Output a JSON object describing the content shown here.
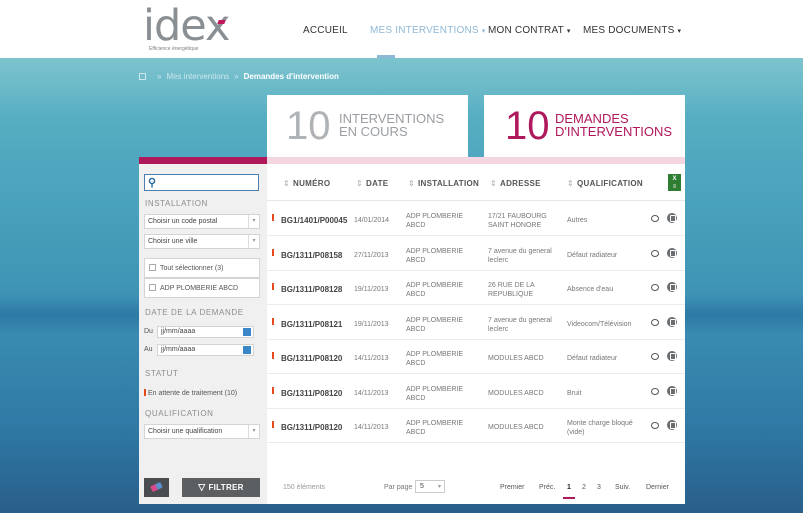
{
  "brand": {
    "logo": "idex",
    "tagline": "Efficience énergétique"
  },
  "nav": [
    {
      "label": "ACCUEIL",
      "caret": ""
    },
    {
      "label": "MES INTERVENTIONS",
      "caret": "▾"
    },
    {
      "label": "MON CONTRAT",
      "caret": "▾"
    },
    {
      "label": "MES DOCUMENTS",
      "caret": "▾"
    }
  ],
  "breadcrumb": {
    "sep": "»",
    "level1": "Mes interventions",
    "current": "Demandes d'intervention"
  },
  "counters": {
    "en_cours": {
      "value": "10",
      "line1": "INTERVENTIONS",
      "line2": "EN COURS"
    },
    "demandes": {
      "value": "10",
      "line1": "DEMANDES",
      "line2": "D'INTERVENTIONS"
    }
  },
  "sidebar": {
    "installation_title": "INSTALLATION",
    "code_postal": "Choisir un code postal",
    "ville": "Choisir une ville",
    "select_all": "Tout sélectionner (3)",
    "option1": "ADP PLOMBERIE ABCD",
    "date_title": "DATE DE LA DEMANDE",
    "du_label": "Du",
    "au_label": "Au",
    "date_placeholder": "jj/mm/aaaa",
    "statut_title": "STATUT",
    "statut_item": "En attente de traitement (10)",
    "qualification_title": "QUALIFICATION",
    "qualification_select": "Choisir une qualification",
    "filter_label": "FILTRER"
  },
  "table": {
    "headers": {
      "numero": "NUMÉRO",
      "date": "DATE",
      "installation": "INSTALLATION",
      "adresse": "ADRESSE",
      "qualification": "QUALIFICATION"
    },
    "sort_glyph": "⇕",
    "rows": [
      {
        "numero": "BG1/1401/P00045",
        "date": "14/01/2014",
        "installation": [
          "ADP PLOMBERIE",
          "ABCD"
        ],
        "adresse": [
          "17/21 FAUBOURG",
          "SAINT HONORE"
        ],
        "qualification": [
          "Autres"
        ]
      },
      {
        "numero": "BG/1311/P08158",
        "date": "27/11/2013",
        "installation": [
          "ADP PLOMBERIE",
          "ABCD"
        ],
        "adresse": [
          "7 avenue du general",
          "leclerc"
        ],
        "qualification": [
          "Défaut radiateur"
        ]
      },
      {
        "numero": "BG/1311/P08128",
        "date": "19/11/2013",
        "installation": [
          "ADP PLOMBERIE",
          "ABCD"
        ],
        "adresse": [
          "26 RUE DE LA",
          "REPUBLIQUE"
        ],
        "qualification": [
          "Absence d'eau"
        ]
      },
      {
        "numero": "BG/1311/P08121",
        "date": "19/11/2013",
        "installation": [
          "ADP PLOMBERIE",
          "ABCD"
        ],
        "adresse": [
          "7 avenue du general",
          "leclerc"
        ],
        "qualification": [
          "Videocom/Télévision"
        ]
      },
      {
        "numero": "BG/1311/P08120",
        "date": "14/11/2013",
        "installation": [
          "ADP PLOMBERIE",
          "ABCD"
        ],
        "adresse": [
          "MODULES ABCD"
        ],
        "qualification": [
          "Défaut radiateur"
        ]
      },
      {
        "numero": "BG/1311/P08120",
        "date": "14/11/2013",
        "installation": [
          "ADP PLOMBERIE",
          "ABCD"
        ],
        "adresse": [
          "MODULES ABCD"
        ],
        "qualification": [
          "Bruit"
        ]
      },
      {
        "numero": "BG/1311/P08120",
        "date": "14/11/2013",
        "installation": [
          "ADP PLOMBERIE",
          "ABCD"
        ],
        "adresse": [
          "MODULES ABCD"
        ],
        "qualification": [
          "Monte charge bloqué",
          "(vide)"
        ]
      }
    ]
  },
  "pager": {
    "count": "150 éléments",
    "per_page_label": "Par page",
    "per_page_value": "5",
    "first": "Premier",
    "prev": "Préc.",
    "pages": [
      "1",
      "2",
      "3"
    ],
    "current_page": "1",
    "next": "Suiv.",
    "last": "Dernier"
  },
  "colors": {
    "brand": "#b0185c",
    "nav_active": "#8fb8d6",
    "flag": "#e64a19",
    "excel": "#2e7d32"
  },
  "icons": {
    "search": "search-icon",
    "excel": "excel-export-icon",
    "calendar": "calendar-icon",
    "comment": "comment-icon",
    "document": "document-icon",
    "eraser": "eraser-icon",
    "funnel": "funnel-icon"
  }
}
